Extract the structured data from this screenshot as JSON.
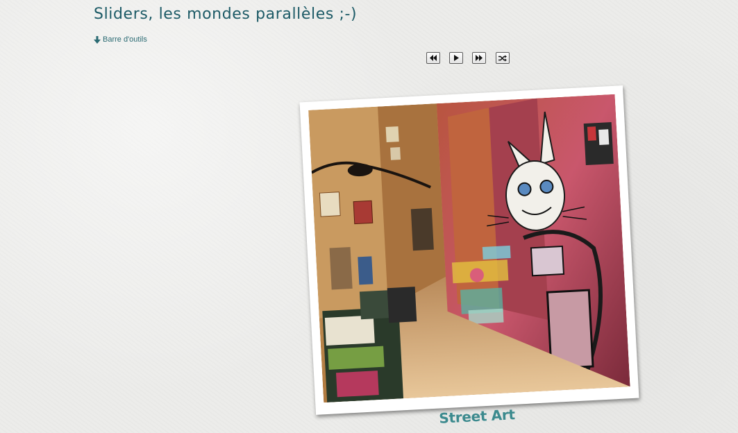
{
  "page": {
    "title": "Sliders, les mondes parallèles ;-)"
  },
  "toolbar_link": {
    "label": "Barre d'outils",
    "icon": "arrow-down-icon"
  },
  "controls": {
    "buttons": [
      {
        "name": "previous",
        "icon": "rewind-icon"
      },
      {
        "name": "play",
        "icon": "play-icon"
      },
      {
        "name": "next",
        "icon": "fast-forward-icon"
      },
      {
        "name": "shuffle",
        "icon": "shuffle-icon"
      }
    ]
  },
  "slide": {
    "caption": "Street Art"
  },
  "colors": {
    "title": "#1c5a66",
    "link": "#2a6a72",
    "caption": "#3c8a8e",
    "background": "#ececea"
  }
}
